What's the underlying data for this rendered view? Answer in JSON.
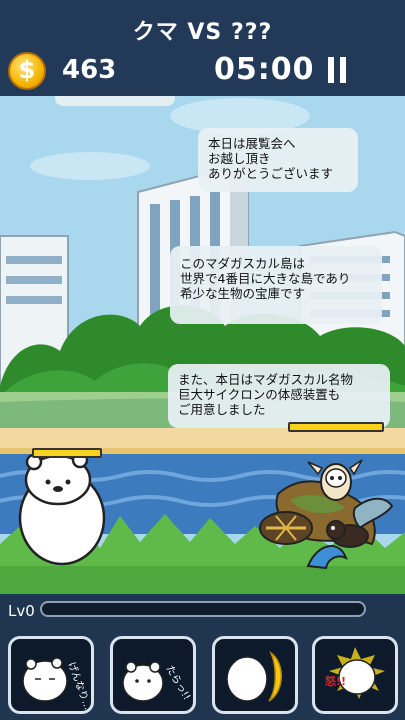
{
  "header": {
    "title": "クマ VS ???",
    "coin_symbol": "$",
    "coins": "463",
    "timer": "05:00"
  },
  "bubbles": [
    "本日は展覧会へ\nお越し頂き\nありがとうございます",
    "このマダガスカル島は\n世界で4番目に大きな島であり\n希少な生物の宝庫です",
    "また、本日はマダガスカル名物\n巨大サイクロンの体感装置も\nご用意しました"
  ],
  "level": {
    "label": "Lv0",
    "progress": 0
  },
  "skills": [
    {
      "icon": "bear-sleepy-icon",
      "caption": "げんなり…"
    },
    {
      "icon": "bear-happy-icon",
      "caption": "たらっ!!"
    },
    {
      "icon": "bear-moon-icon",
      "caption": ""
    },
    {
      "icon": "bear-angry-icon",
      "caption": "怒!!"
    }
  ],
  "colors": {
    "header_bg": "#223a57",
    "hp_bar": "#fbd21b",
    "sky": "#a9d8ee",
    "grass": "#5fba4a"
  }
}
